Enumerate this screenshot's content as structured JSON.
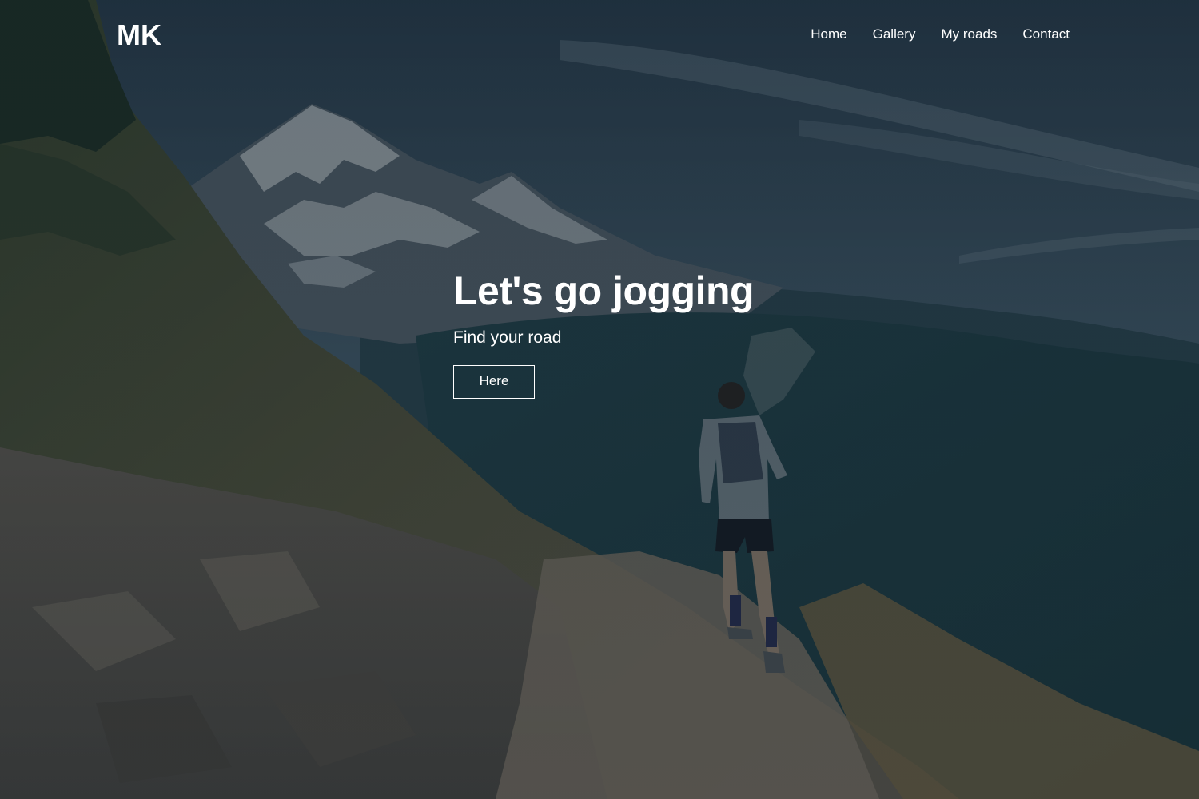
{
  "brand": {
    "logo_text": "MK"
  },
  "nav": {
    "items": [
      {
        "label": "Home"
      },
      {
        "label": "Gallery"
      },
      {
        "label": "My roads"
      },
      {
        "label": "Contact"
      }
    ]
  },
  "hero": {
    "title": "Let's go jogging",
    "subtitle": "Find your road",
    "cta_label": "Here",
    "background_image": "photo of a trail runner on a mountain ridge path with a snowy peak and forested valley, dark overlay"
  },
  "colors": {
    "text": "#ffffff",
    "overlay": "#14202a",
    "sky": "#3a5566",
    "forest": "#1f4149",
    "trail": "#6b6055"
  }
}
